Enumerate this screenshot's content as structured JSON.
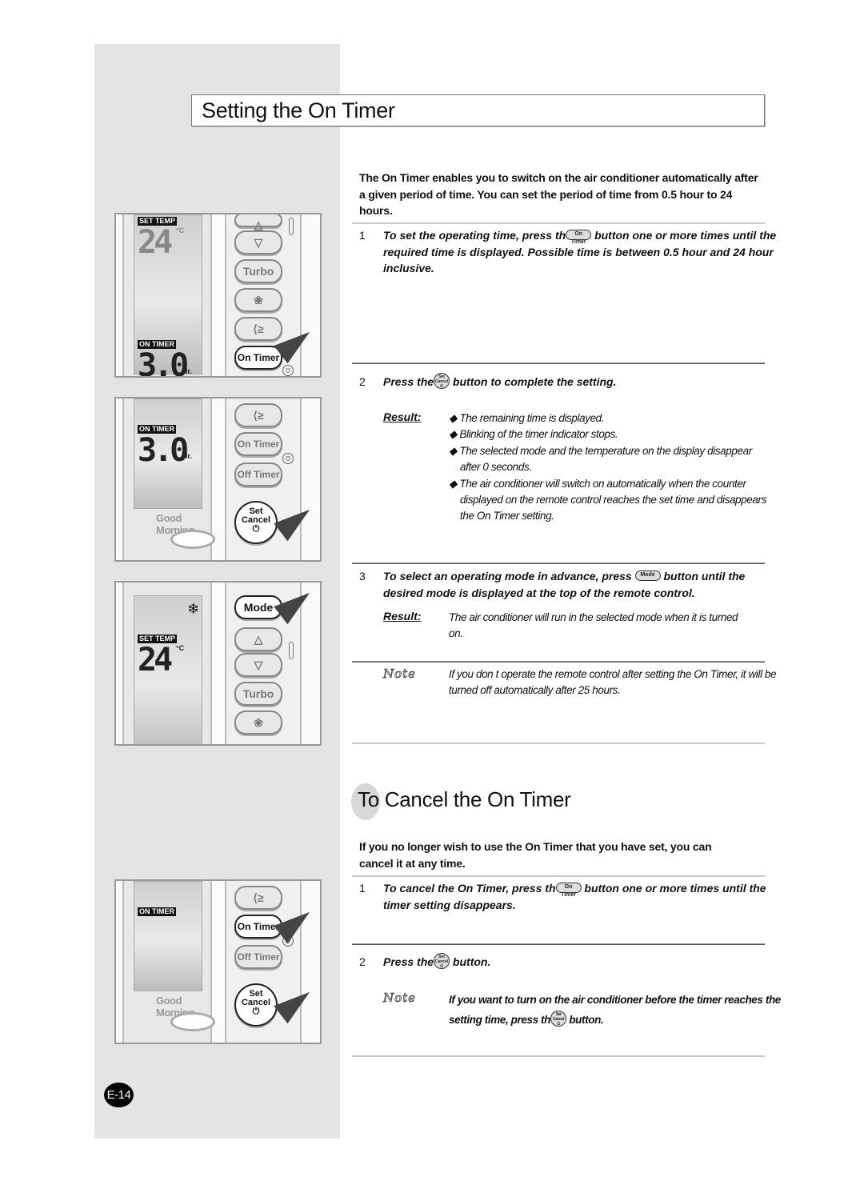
{
  "section1": {
    "title": "Setting the On Timer",
    "intro": "The On Timer enables you to switch on the air conditioner automatically after a given period of time. You can set the period of time from 0.5 hour to 24 hours.",
    "steps": [
      {
        "num": "1",
        "text_before": "To set the operating time, press th",
        "button": "On Timer",
        "text_after": " button one or more times until the required time is displayed. Possible time is between 0.5 hour and 24 hour inclusive."
      },
      {
        "num": "2",
        "text_before": "Press the",
        "button": "Set Cancel",
        "text_after": " button to complete the setting.",
        "result_label": "Result:",
        "results": [
          "The remaining time is displayed.",
          "Blinking of the timer indicator stops.",
          "The selected mode and the temperature on the display disappear after    0 seconds.",
          "The air conditioner will switch on automatically when the counter displayed on the remote control reaches the set time and disappears the On Timer setting."
        ]
      },
      {
        "num": "3",
        "text_before": "To select an operating mode in advance, press ",
        "button": "Mode",
        "text_after": " button until the desired mode is displayed at the top of the remote control.",
        "result_label": "Result:",
        "result_text": "The air conditioner will run in the selected mode when it is turned on."
      }
    ],
    "note": {
      "label": "Note",
      "text": "If you don    t operate the remote control after setting the On Timer, it will be turned off automatically after 25 hours."
    }
  },
  "section2": {
    "title_prefix": "To",
    "title_rest": " Cancel the On Timer",
    "intro": "If you no longer wish to use the On Timer that you have set, you can cancel it at any time.",
    "steps": [
      {
        "num": "1",
        "text_before": "To cancel the On Timer, press th",
        "button": "On Timer",
        "text_after": " button one or more times until the timer setting disappears."
      },
      {
        "num": "2",
        "text_before": "Press the",
        "button": "Set Cancel",
        "text_after": " button."
      }
    ],
    "note": {
      "label": "Note",
      "text_before": "If you want to turn on the air conditioner before the timer reaches the setting time, press th",
      "button": "Set Cancel",
      "text_after": " button."
    }
  },
  "remote": {
    "set_temp": "SET TEMP",
    "temp_value": "24",
    "temp_unit": "°C",
    "on_timer_label": "ON TIMER",
    "timer_value": "3.0",
    "timer_unit": "Hr.",
    "good_morning": "Good Morning",
    "buttons": {
      "up": "△",
      "down": "▽",
      "turbo": "Turbo",
      "fan": "❀",
      "swing": "⟨≥",
      "on_timer": "On Timer",
      "off_timer": "Off Timer",
      "set": "Set",
      "cancel": "Cancel",
      "power": "⏻",
      "mode": "Mode"
    },
    "mode_icon": "❄"
  },
  "page_number": "E-14"
}
